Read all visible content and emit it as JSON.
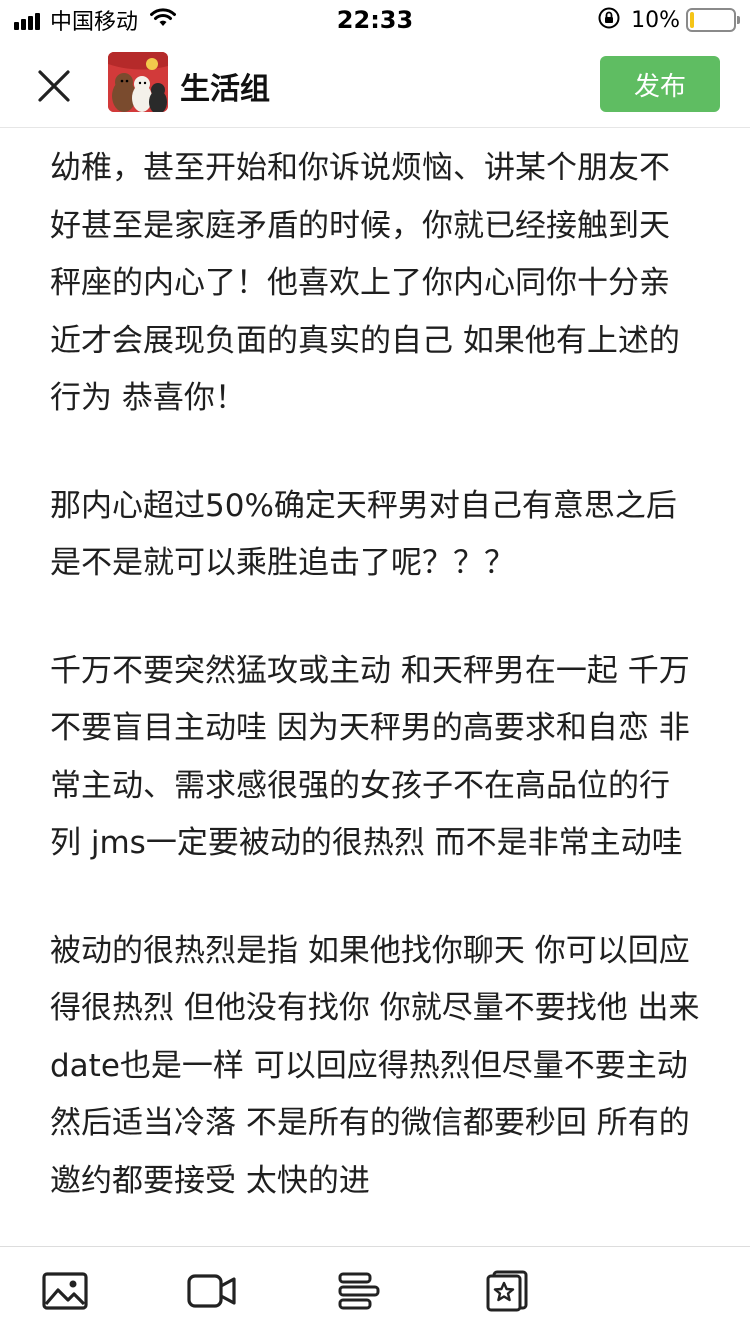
{
  "status_bar": {
    "carrier": "中国移动",
    "time": "22:33",
    "battery_percent": "10%",
    "battery_level": 0.1,
    "icons": [
      "signal-icon",
      "wifi-icon",
      "rotation-lock-icon",
      "battery-icon"
    ]
  },
  "header": {
    "close_icon": "close-icon",
    "group_name": "生活组",
    "publish_label": "发布"
  },
  "content": {
    "paragraphs": [
      "幼稚，甚至开始和你诉说烦恼、讲某个朋友不好甚至是家庭矛盾的时候，你就已经接触到天秤座的内心了！他喜欢上了你内心同你十分亲近才会展现负面的真实的自己 如果他有上述的行为 恭喜你！",
      "那内心超过50%确定天秤男对自己有意思之后 是不是就可以乘胜追击了呢？？？",
      "千万不要突然猛攻或主动 和天秤男在一起 千万不要盲目主动哇 因为天秤男的高要求和自恋 非常主动、需求感很强的女孩子不在高品位的行列 jms一定要被动的很热烈 而不是非常主动哇",
      "被动的很热烈是指 如果他找你聊天 你可以回应得很热烈 但他没有找你 你就尽量不要找他 出来date也是一样 可以回应得热烈但尽量不要主动 然后适当冷落 不是所有的微信都要秒回 所有的邀约都要接受 太快的进"
    ]
  },
  "toolbar": {
    "items": [
      "image-icon",
      "video-icon",
      "text-format-icon",
      "sticker-icon"
    ]
  },
  "colors": {
    "publish_green": "#5fbd62",
    "battery_yellow": "#f5c518",
    "text": "#1f1f1f"
  }
}
